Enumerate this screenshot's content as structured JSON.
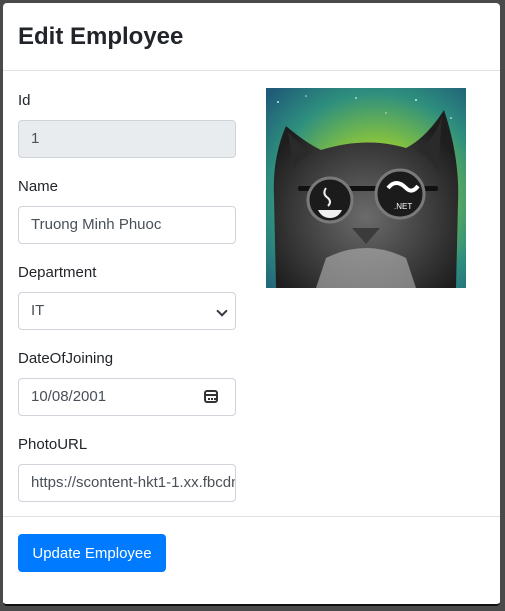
{
  "modal": {
    "title": "Edit Employee"
  },
  "form": {
    "id": {
      "label": "Id",
      "value": "1"
    },
    "name": {
      "label": "Name",
      "value": "Truong Minh Phuoc"
    },
    "department": {
      "label": "Department",
      "value": "IT"
    },
    "date_of_joining": {
      "label": "DateOfJoining",
      "value": "10/08/2001"
    },
    "photo_url": {
      "label": "PhotoURL",
      "value": "https://scontent-hkt1-1.xx.fbcdn"
    }
  },
  "photo": {
    "alt": "Employee photo: cat wearing sunglasses with Java and .NET logos",
    "left_lens_logo": "java",
    "right_lens_logo": ".NET"
  },
  "footer": {
    "update_label": "Update Employee"
  },
  "colors": {
    "primary": "#007bff",
    "readonly_bg": "#e9ecef",
    "border": "#ced4da"
  },
  "icons": [
    "chevron-down-icon",
    "calendar-icon"
  ]
}
